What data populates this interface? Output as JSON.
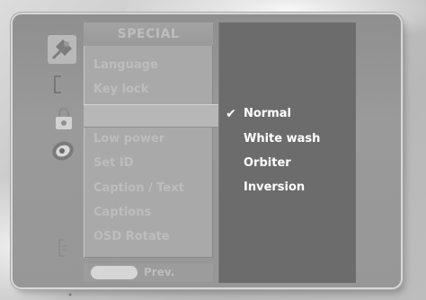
{
  "menu": {
    "title": "SPECIAL",
    "items": [
      {
        "label": "Language"
      },
      {
        "label": "Key lock"
      },
      {
        "label": ""
      },
      {
        "label": ""
      },
      {
        "label": "Low power"
      },
      {
        "label": "Set ID"
      },
      {
        "label": "Caption / Text"
      },
      {
        "label": "Captions"
      },
      {
        "label": "OSD Rotate"
      }
    ],
    "selected_index": 2,
    "prev_label": "Prev."
  },
  "options": {
    "items": [
      {
        "label": "Normal",
        "checked": true
      },
      {
        "label": "White wash",
        "checked": false
      },
      {
        "label": "Orbiter",
        "checked": false
      },
      {
        "label": "Inversion",
        "checked": false
      }
    ],
    "check_glyph": "✔"
  },
  "icons": {
    "category_icons": [
      "satellite-icon",
      "bracket-icon",
      "lock-icon",
      "disc-icon",
      "small-bracket-icon",
      "dot-icon"
    ]
  },
  "colors": {
    "frame": "#979797",
    "menu_panel": "#a9a9a9",
    "options_panel": "#6c6c6c",
    "option_text": "#ffffff",
    "menu_text": "#bdbdbd"
  }
}
